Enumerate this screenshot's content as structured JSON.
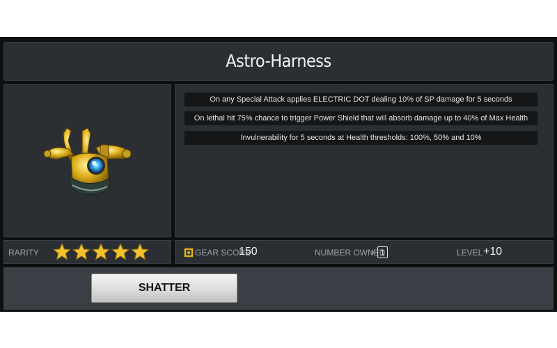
{
  "item": {
    "name": "Astro-Harness",
    "icon": "astro-harness-gear-icon"
  },
  "effects": [
    "On any Special Attack applies ELECTRIC DOT dealing 10% of SP damage for 5 seconds",
    "On lethal hit 75% chance to trigger Power Shield that will absorb damage up to 40% of Max Health",
    "Invulnerability for 5 seconds at Health thresholds: 100%, 50% and 10%"
  ],
  "rarity": {
    "label": "RARITY",
    "stars": 5,
    "max_stars": 5
  },
  "stats": {
    "gear_score_label": "GEAR SCORE",
    "gear_score": "150",
    "number_owned_label": "NUMBER OWNED",
    "number_owned_prefix": "×",
    "number_owned": "1",
    "level_label": "LEVEL",
    "level": "+10"
  },
  "actions": {
    "shatter_label": "SHATTER"
  },
  "colors": {
    "star_gold": "#f2c12e",
    "gear_score_icon": "#e0b21c",
    "panel_bg": "#2b2f33",
    "effect_bg": "#141618"
  }
}
